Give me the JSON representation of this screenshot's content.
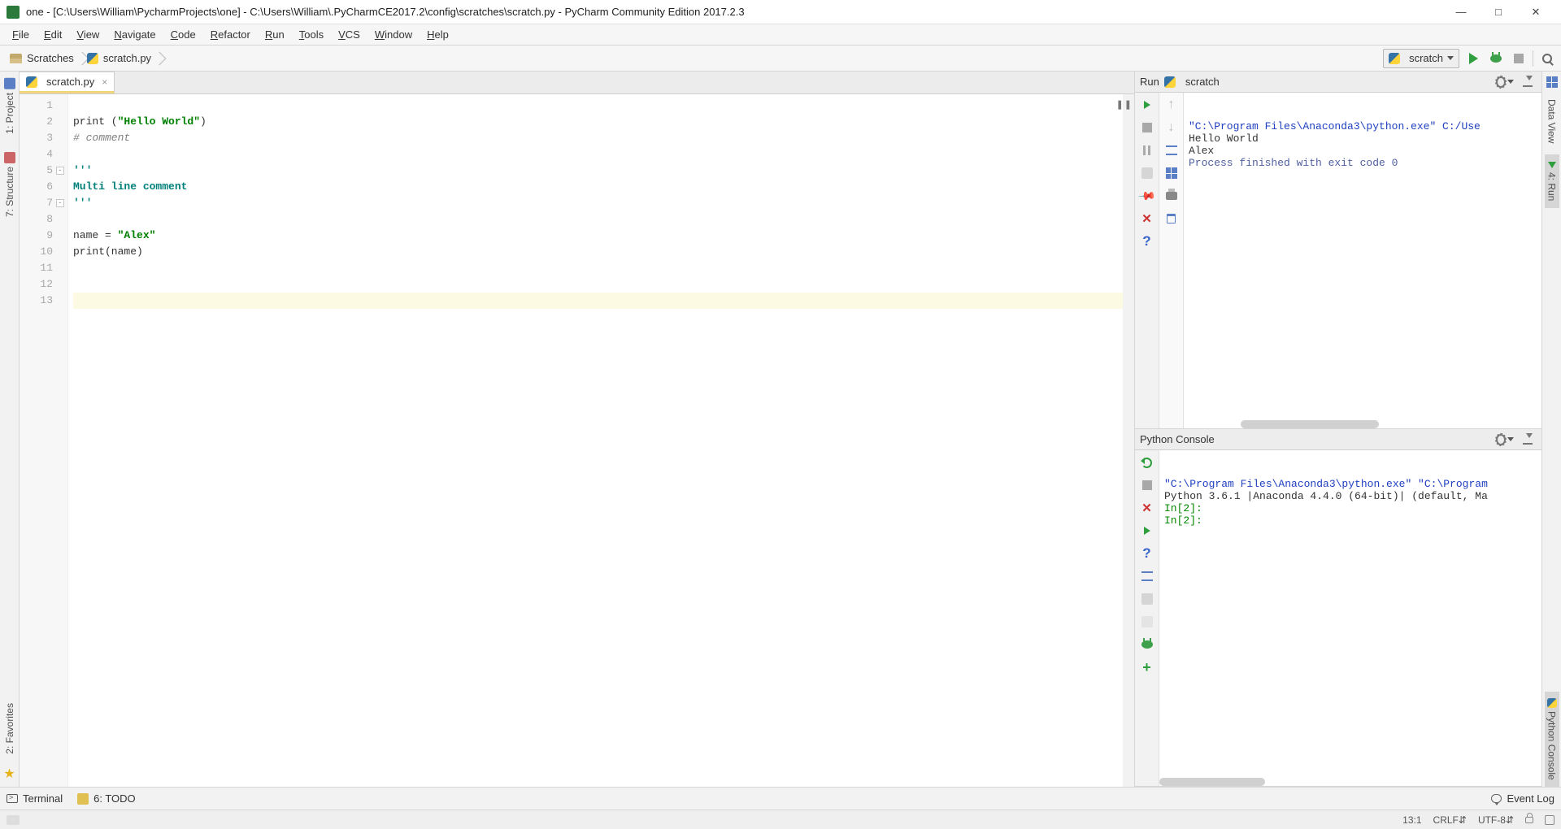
{
  "title": "one - [C:\\Users\\William\\PycharmProjects\\one] - C:\\Users\\William\\.PyCharmCE2017.2\\config\\scratches\\scratch.py - PyCharm Community Edition 2017.2.3",
  "menu": [
    "File",
    "Edit",
    "View",
    "Navigate",
    "Code",
    "Refactor",
    "Run",
    "Tools",
    "VCS",
    "Window",
    "Help"
  ],
  "breadcrumbs": [
    {
      "icon": "folder",
      "label": "Scratches"
    },
    {
      "icon": "python",
      "label": "scratch.py"
    }
  ],
  "run_config_selected": "scratch",
  "left_tabs": [
    {
      "label": "1: Project"
    },
    {
      "label": "7: Structure"
    },
    {
      "label": "2: Favorites"
    }
  ],
  "right_tabs": [
    {
      "label": "Data View"
    },
    {
      "label": "4: Run",
      "selected": true
    },
    {
      "label": "Python Console",
      "selected": true
    }
  ],
  "editor": {
    "tab_label": "scratch.py",
    "line_count": 13,
    "current_line": 13,
    "code": [
      {
        "n": 1,
        "html": ""
      },
      {
        "n": 2,
        "html": "print (<span class='str'>\"Hello World\"</span>)"
      },
      {
        "n": 3,
        "html": "<span class='cmt'># comment</span>"
      },
      {
        "n": 4,
        "html": ""
      },
      {
        "n": 5,
        "html": "<span class='docstr'>'''</span>"
      },
      {
        "n": 6,
        "html": "<span class='docstr'>Multi line comment</span>"
      },
      {
        "n": 7,
        "html": "<span class='docstr'>'''</span>"
      },
      {
        "n": 8,
        "html": ""
      },
      {
        "n": 9,
        "html": "name = <span class='str'>\"Alex\"</span>"
      },
      {
        "n": 10,
        "html": "print(name)"
      },
      {
        "n": 11,
        "html": ""
      },
      {
        "n": 12,
        "html": ""
      },
      {
        "n": 13,
        "html": ""
      }
    ]
  },
  "run_panel": {
    "title_prefix": "Run",
    "title": "scratch",
    "output": [
      {
        "cls": "path-blue",
        "text": "\"C:\\Program Files\\Anaconda3\\python.exe\" C:/Use"
      },
      {
        "cls": "",
        "text": "Hello World"
      },
      {
        "cls": "",
        "text": "Alex"
      },
      {
        "cls": "",
        "text": ""
      },
      {
        "cls": "process-txt",
        "text": "Process finished with exit code 0"
      }
    ]
  },
  "console_panel": {
    "title": "Python Console",
    "output": [
      {
        "cls": "path-blue",
        "text": "\"C:\\Program Files\\Anaconda3\\python.exe\" \"C:\\Program"
      },
      {
        "cls": "",
        "text": "Python 3.6.1 |Anaconda 4.4.0 (64-bit)| (default, Ma"
      },
      {
        "cls": "prompt-green",
        "text": "In[2]:"
      },
      {
        "cls": "",
        "text": ""
      },
      {
        "cls": "prompt-green",
        "text": "In[2]: "
      }
    ]
  },
  "bottom_tools": {
    "terminal": "Terminal",
    "todo": "6: TODO",
    "eventlog": "Event Log"
  },
  "status": {
    "pos": "13:1",
    "eol": "CRLF",
    "enc": "UTF-8"
  }
}
